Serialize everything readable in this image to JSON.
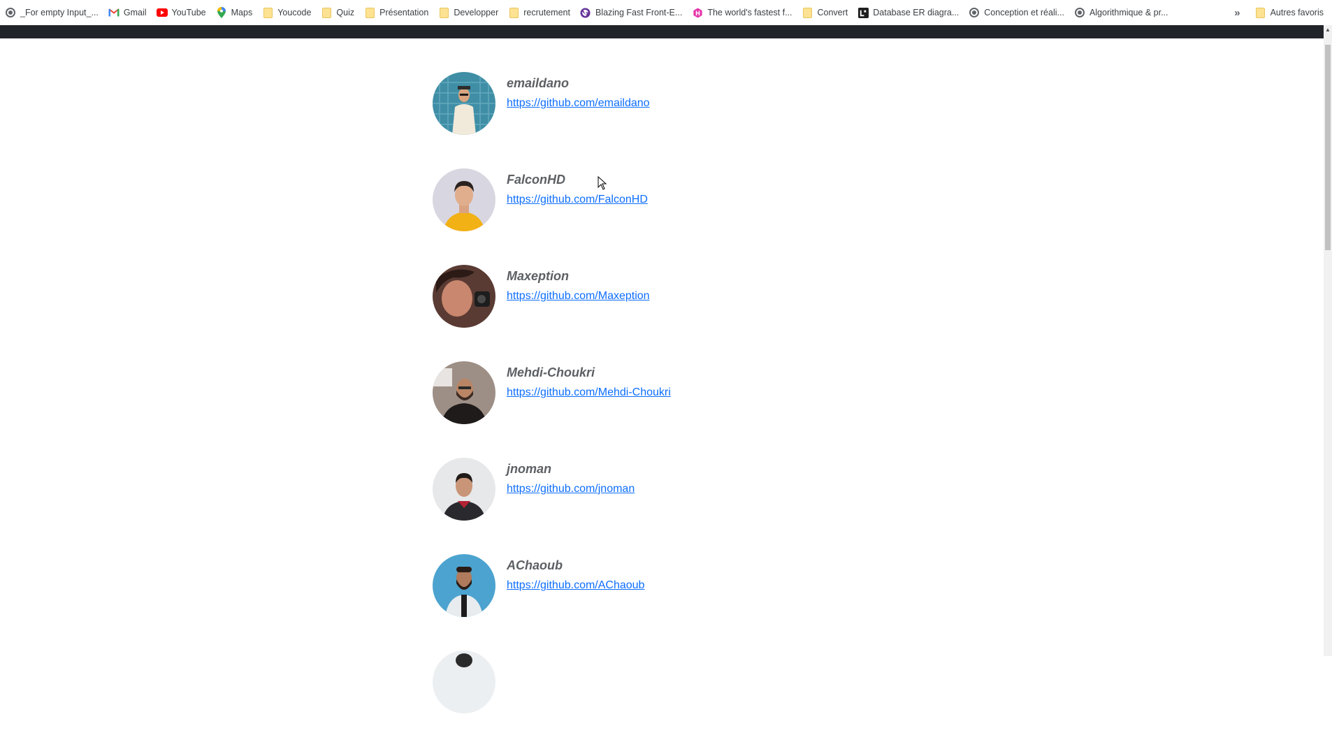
{
  "bookmarks": [
    {
      "label": "_For empty Input_...",
      "icon": "globe-icon"
    },
    {
      "label": "Gmail",
      "icon": "gmail-icon"
    },
    {
      "label": "YouTube",
      "icon": "youtube-icon"
    },
    {
      "label": "Maps",
      "icon": "maps-icon"
    },
    {
      "label": "Youcode",
      "icon": "folder-icon"
    },
    {
      "label": "Quiz",
      "icon": "folder-icon"
    },
    {
      "label": "Présentation",
      "icon": "folder-icon"
    },
    {
      "label": "Developper",
      "icon": "folder-icon"
    },
    {
      "label": "recrutement",
      "icon": "folder-icon"
    },
    {
      "label": "Blazing Fast Front-E...",
      "icon": "gatsby-icon"
    },
    {
      "label": "The world's fastest f...",
      "icon": "hasura-icon"
    },
    {
      "label": "Convert",
      "icon": "folder-icon"
    },
    {
      "label": "Database ER diagra...",
      "icon": "dbdiagram-icon"
    },
    {
      "label": "Conception et réali...",
      "icon": "globe-icon"
    },
    {
      "label": "Algorithmique & pr...",
      "icon": "globe-icon"
    }
  ],
  "more_bookmarks": "»",
  "other_bookmarks": "Autres favoris",
  "contributors": [
    {
      "username": "emaildano",
      "url": "https://github.com/emaildano"
    },
    {
      "username": "FalconHD",
      "url": "https://github.com/FalconHD"
    },
    {
      "username": "Maxeption",
      "url": "https://github.com/Maxeption"
    },
    {
      "username": "Mehdi-Choukri",
      "url": "https://github.com/Mehdi-Choukri"
    },
    {
      "username": "jnoman",
      "url": "https://github.com/jnoman"
    },
    {
      "username": "AChaoub",
      "url": "https://github.com/AChaoub"
    }
  ],
  "colors": {
    "link": "#0d6efd",
    "username": "#5c6064",
    "navbar": "#212529"
  }
}
